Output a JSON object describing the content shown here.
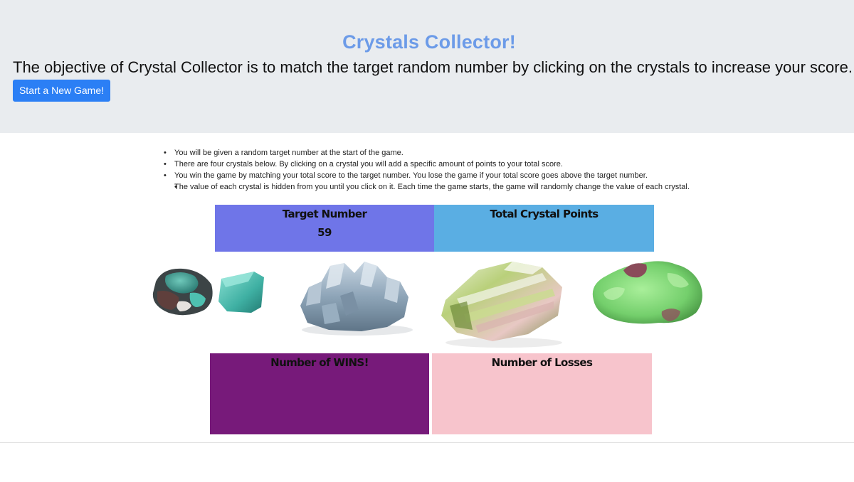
{
  "header": {
    "title": "Crystals Collector!",
    "objective": "The objective of Crystal Collector is to match the target random number by clicking on the crystals to increase your score.",
    "new_game_label": "Start a New Game!"
  },
  "rules": [
    "You will be given a random target number at the start of the game.",
    "There are four crystals below. By clicking on a crystal you will add a specific amount of points to your total score.",
    "You win the game by matching your total score to the target number. You lose the game if your total score goes above the target number.",
    "The value of each crystal is hidden from you until you click on it. Each time the game starts, the game will randomly change the value of each crystal."
  ],
  "scoreboard": {
    "target_label": "Target Number",
    "target_value": "59",
    "points_label": "Total Crystal Points",
    "points_value": "",
    "wins_label": "Number of WINS!",
    "wins_value": "",
    "losses_label": "Number of Losses",
    "losses_value": ""
  },
  "crystals": [
    {
      "icon": "amazonite-crystal-icon"
    },
    {
      "icon": "celestite-crystal-icon"
    },
    {
      "icon": "tourmaline-crystal-icon"
    },
    {
      "icon": "chrysoprase-crystal-icon"
    }
  ],
  "colors": {
    "title": "#6c9be8",
    "button": "#2b7ff5",
    "target_box": "#6f75e8",
    "points_box": "#5aaee3",
    "wins_box": "#771a7a",
    "losses_box": "#f7c4cc"
  }
}
